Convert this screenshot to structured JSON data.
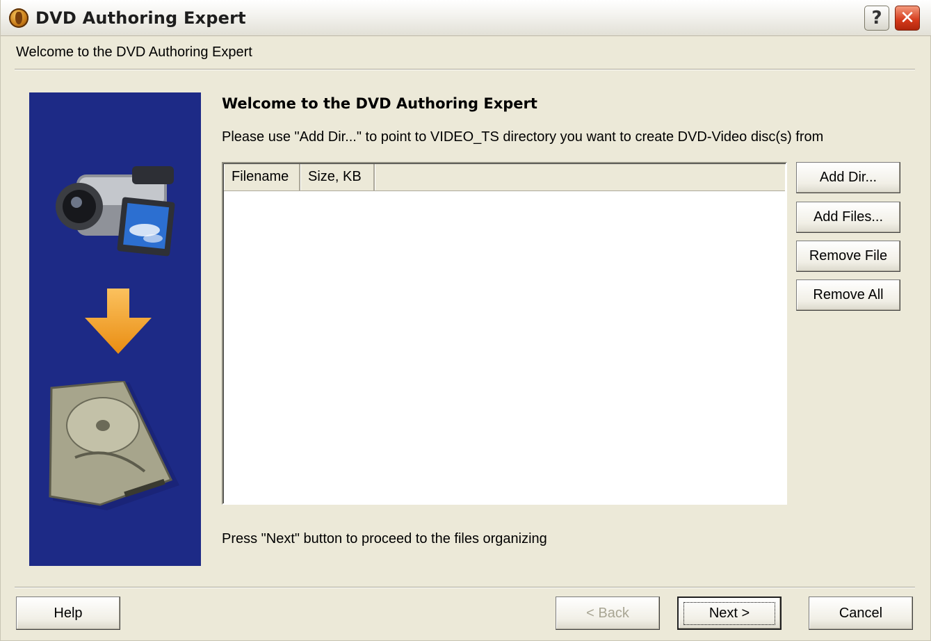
{
  "window": {
    "title": "DVD Authoring Expert",
    "help_glyph": "?",
    "close_glyph": "✕"
  },
  "header": {
    "text": "Welcome to the DVD Authoring Expert"
  },
  "main": {
    "title": "Welcome to the DVD Authoring Expert",
    "instruction": "Please use \"Add Dir...\" to point to VIDEO_TS directory you want to create DVD-Video disc(s) from",
    "file_list": {
      "columns": [
        "Filename",
        "Size, KB",
        ""
      ],
      "rows": []
    },
    "footer_hint": "Press \"Next\" button to proceed to the files organizing"
  },
  "side_buttons": {
    "add_dir": "Add Dir...",
    "add_files": "Add Files...",
    "remove_file": "Remove File",
    "remove_all": "Remove All"
  },
  "nav_buttons": {
    "help": "Help",
    "back": "< Back",
    "next": "Next >",
    "cancel": "Cancel"
  },
  "illustration": {
    "icons": [
      "camcorder-icon",
      "arrow-down-icon",
      "hard-drive-icon"
    ],
    "panel_color": "#1d2a86",
    "arrow_color": "#f5a623"
  }
}
